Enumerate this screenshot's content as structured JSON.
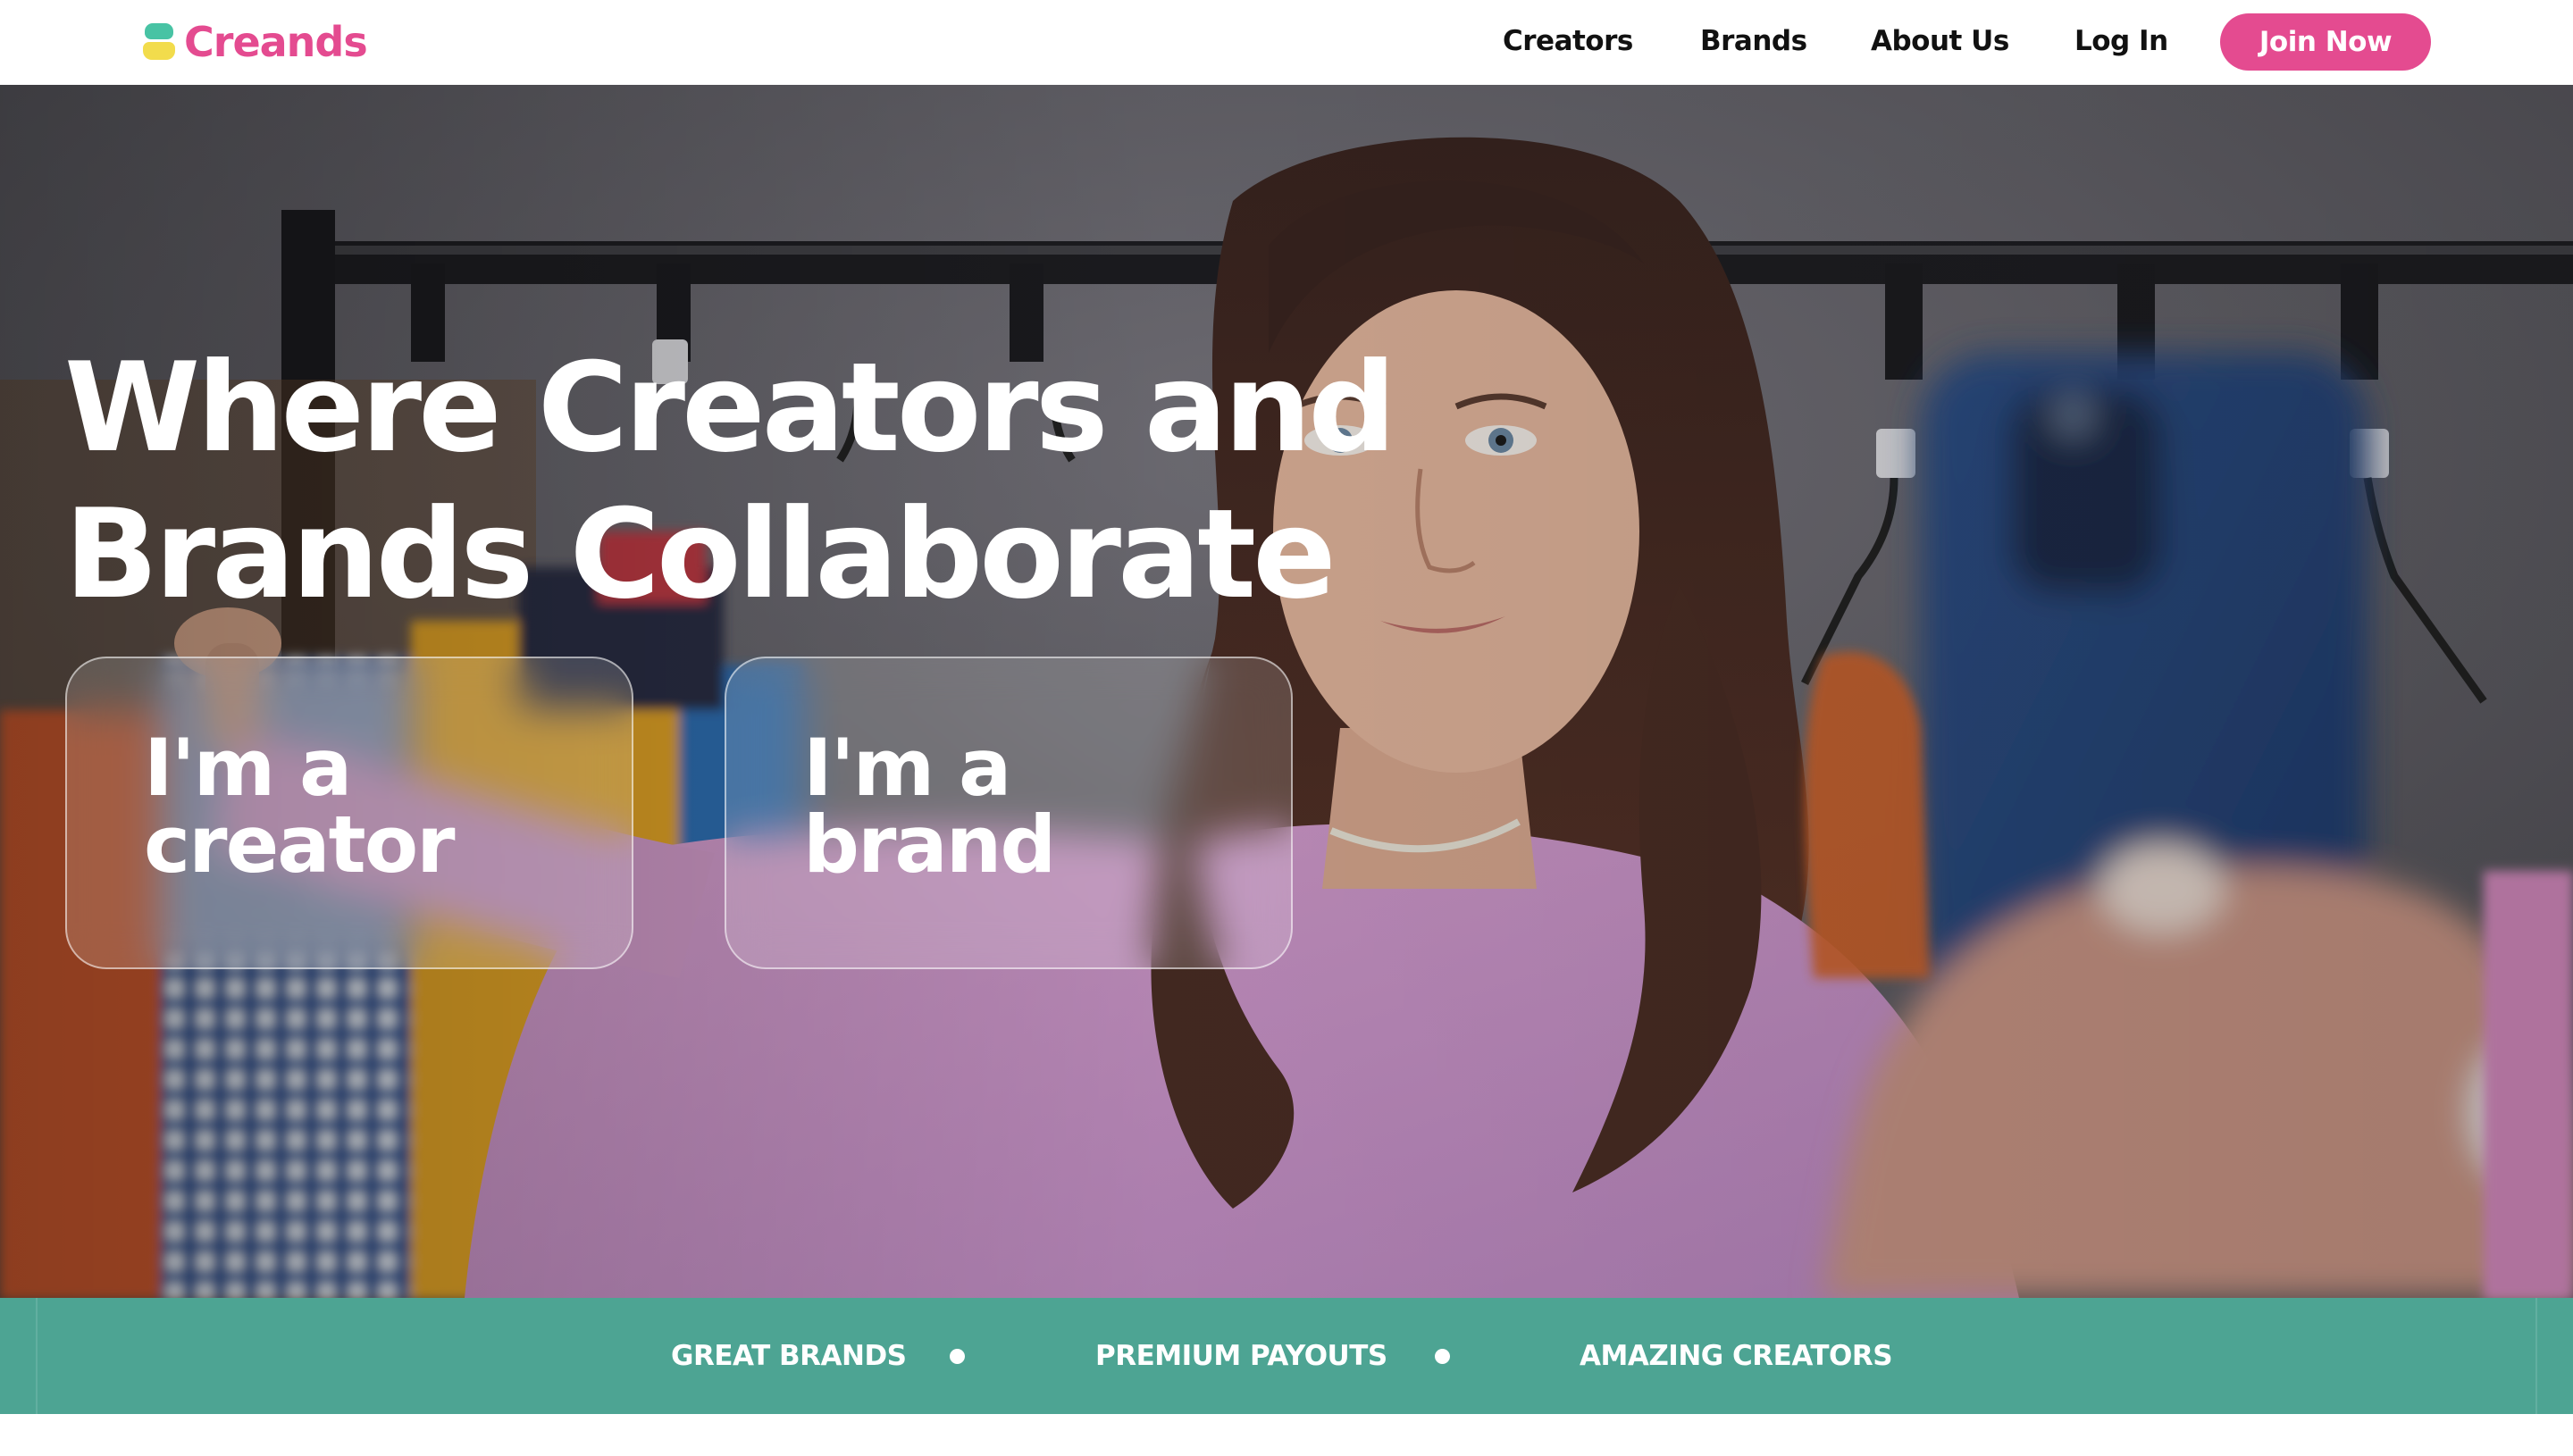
{
  "brand": {
    "name": "Creands"
  },
  "nav": {
    "links": [
      {
        "label": "Creators"
      },
      {
        "label": "Brands"
      },
      {
        "label": "About Us"
      },
      {
        "label": "Log In"
      }
    ],
    "cta": {
      "label": "Join Now"
    }
  },
  "hero": {
    "headline_line1": "Where Creators and",
    "headline_line2": "Brands Collaborate",
    "cards": [
      {
        "line1": "I'm a",
        "line2": "creator"
      },
      {
        "line1": "I'm a",
        "line2": "brand"
      }
    ]
  },
  "ticker": {
    "items": [
      "GREAT BRANDS",
      "PREMIUM PAYOUTS",
      "AMAZING CREATORS"
    ]
  },
  "colors": {
    "brand_pink": "#e44b90",
    "logo_teal": "#48c3a4",
    "logo_yellow": "#f2dc4c",
    "ticker_green": "#4da493",
    "nav_text": "#111111"
  }
}
